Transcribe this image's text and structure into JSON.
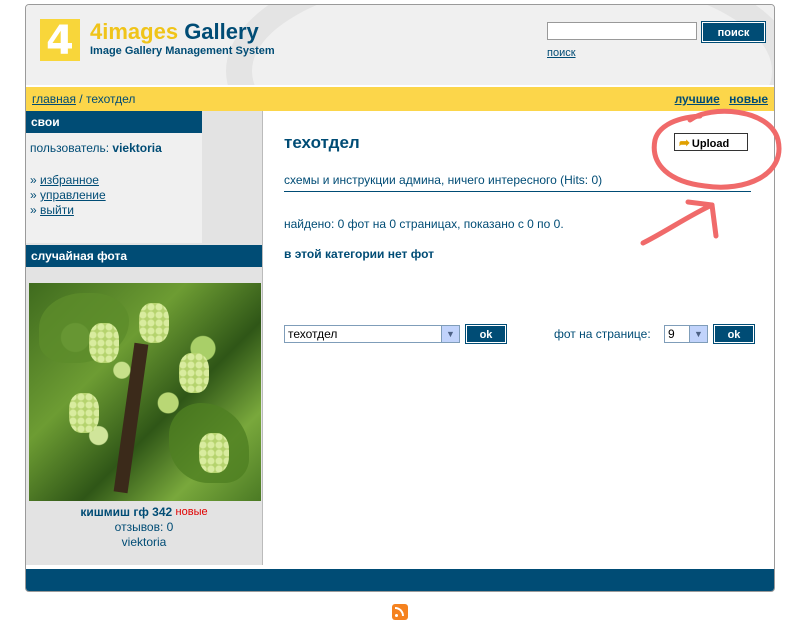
{
  "header": {
    "logo_digit": "4",
    "logo_title_a": "4images",
    "logo_title_b": "Gallery",
    "logo_subtitle": "Image Gallery Management System",
    "search_button": "поиск",
    "search_link": "поиск",
    "search_placeholder": ""
  },
  "nav": {
    "crumb_home": "главная",
    "crumb_sep": " / ",
    "crumb_current": "техотдел",
    "link_top": "лучшие",
    "link_new": "новые"
  },
  "sidebar": {
    "user_heading": "свои",
    "user_label": "пользователь:",
    "user_name": "viektoria",
    "menu": [
      {
        "label": "избранное"
      },
      {
        "label": "управление"
      },
      {
        "label": "выйти"
      }
    ],
    "menu_bullet": "»",
    "random_heading": "случайная фота",
    "photo_title": "кишмиш гф 342",
    "photo_new": "новые",
    "photo_comments": "отзывов: 0",
    "photo_user": "viektoria"
  },
  "main": {
    "category_title": "техотдел",
    "upload_button": "Upload",
    "description": "схемы и инструкции админа, ничего интересного (Hits: 0)",
    "found_text": "найдено: 0 фот на 0 страницах, показано с 0 по 0.",
    "empty_text": "в этой категории нет фот",
    "category_select_value": "техотдел",
    "ok_label": "ok",
    "perpage_label": "фот на странице:",
    "perpage_value": "9"
  },
  "colors": {
    "brand_blue": "#004c75",
    "accent_yellow": "#fcd64a",
    "annotation_red": "#f06a6a"
  },
  "icons": [
    "upload-arrow-icon",
    "dropdown-arrow-icon",
    "rss-icon"
  ]
}
